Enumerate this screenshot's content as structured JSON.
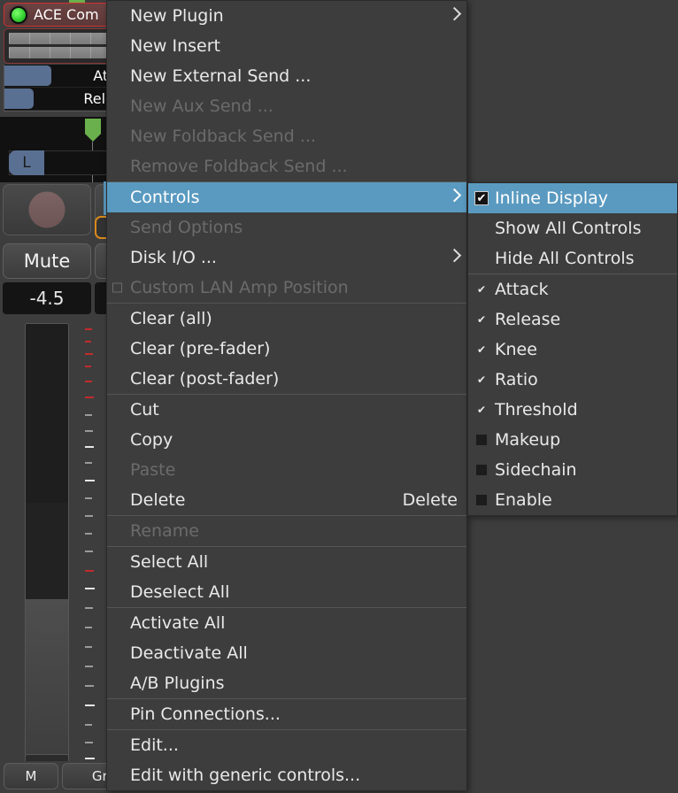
{
  "strip": {
    "plugin_title": "ACE Com",
    "led_color": "#2ecc2e",
    "controls": [
      {
        "label": "Attac",
        "fill_pct": 36
      },
      {
        "label": "Releas",
        "fill_pct": 22
      }
    ],
    "pan_label": "L",
    "mute_label": "Mute",
    "gain_value": "-4.5",
    "bottom_buttons": [
      {
        "label": "M"
      },
      {
        "label": "Grp"
      }
    ],
    "accent_orange": "#d98a1c",
    "accent_blue": "#5a9ac0",
    "fader_blue": "#5a7092"
  },
  "context_menu": {
    "items": [
      {
        "label": "New Plugin",
        "submenu": true,
        "disabled": false
      },
      {
        "label": "New Insert",
        "submenu": false,
        "disabled": false
      },
      {
        "label": "New External Send ...",
        "submenu": false,
        "disabled": false
      },
      {
        "label": "New Aux Send ...",
        "submenu": false,
        "disabled": true
      },
      {
        "label": "New Foldback Send ...",
        "submenu": false,
        "disabled": true
      },
      {
        "label": "Remove Foldback Send ...",
        "submenu": false,
        "disabled": true
      },
      {
        "sep": true
      },
      {
        "label": "Controls",
        "submenu": true,
        "disabled": false,
        "highlight": true
      },
      {
        "label": "Send Options",
        "submenu": false,
        "disabled": true
      },
      {
        "label": "Disk I/O ...",
        "submenu": true,
        "disabled": false
      },
      {
        "label": "Custom LAN Amp Position",
        "submenu": false,
        "disabled": true,
        "checkbox": "empty"
      },
      {
        "sep": true
      },
      {
        "label": "Clear (all)",
        "submenu": false,
        "disabled": false
      },
      {
        "label": "Clear (pre-fader)",
        "submenu": false,
        "disabled": false
      },
      {
        "label": "Clear (post-fader)",
        "submenu": false,
        "disabled": false
      },
      {
        "sep": true
      },
      {
        "label": "Cut",
        "submenu": false,
        "disabled": false
      },
      {
        "label": "Copy",
        "submenu": false,
        "disabled": false
      },
      {
        "label": "Paste",
        "submenu": false,
        "disabled": true
      },
      {
        "label": "Delete",
        "submenu": false,
        "disabled": false,
        "accel": "Delete"
      },
      {
        "sep": true
      },
      {
        "label": "Rename",
        "submenu": false,
        "disabled": true
      },
      {
        "sep": true
      },
      {
        "label": "Select All",
        "submenu": false,
        "disabled": false
      },
      {
        "label": "Deselect All",
        "submenu": false,
        "disabled": false
      },
      {
        "sep": true
      },
      {
        "label": "Activate All",
        "submenu": false,
        "disabled": false
      },
      {
        "label": "Deactivate All",
        "submenu": false,
        "disabled": false
      },
      {
        "label": "A/B Plugins",
        "submenu": false,
        "disabled": false
      },
      {
        "sep": true
      },
      {
        "label": "Pin Connections...",
        "submenu": false,
        "disabled": false
      },
      {
        "sep": true
      },
      {
        "label": "Edit...",
        "submenu": false,
        "disabled": false
      },
      {
        "label": "Edit with generic controls...",
        "submenu": false,
        "disabled": false
      }
    ]
  },
  "submenu": {
    "items": [
      {
        "label": "Inline Display",
        "check": "checked",
        "highlight": true
      },
      {
        "label": "Show All Controls",
        "check": "none"
      },
      {
        "label": "Hide All Controls",
        "check": "none"
      },
      {
        "sep": true
      },
      {
        "label": "Attack",
        "check": "small-checked"
      },
      {
        "label": "Release",
        "check": "small-checked"
      },
      {
        "label": "Knee",
        "check": "small-checked"
      },
      {
        "label": "Ratio",
        "check": "small-checked"
      },
      {
        "label": "Threshold",
        "check": "small-checked"
      },
      {
        "label": "Makeup",
        "check": "small-unchecked"
      },
      {
        "label": "Sidechain",
        "check": "small-unchecked"
      },
      {
        "label": "Enable",
        "check": "small-unchecked"
      }
    ]
  }
}
